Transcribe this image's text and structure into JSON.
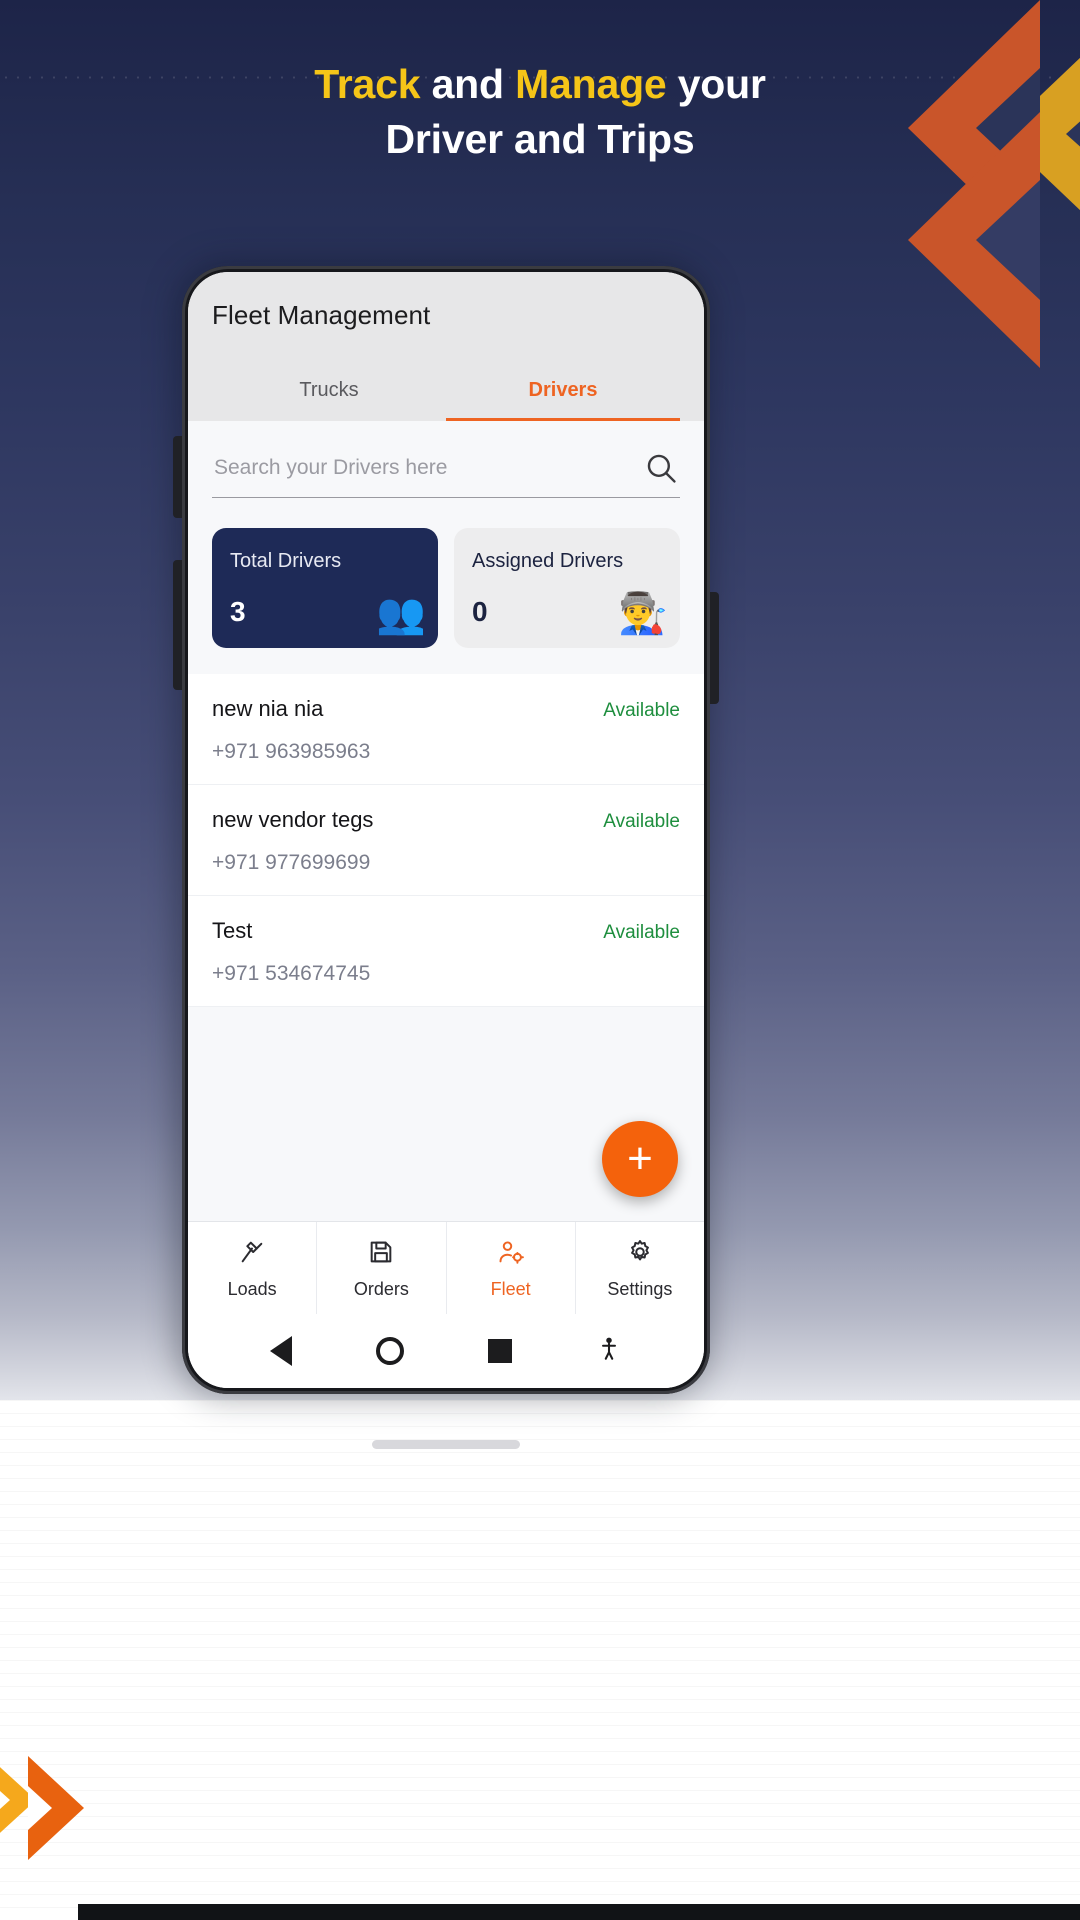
{
  "promo": {
    "headline_part1": "Track",
    "headline_mid1": " and ",
    "headline_part2": "Manage",
    "headline_mid2": " your",
    "headline_line2": "Driver and Trips",
    "accent_gold": "#f5c518",
    "accent_orange": "#c9552a",
    "bg_navy": "#2b3459"
  },
  "app": {
    "title": "Fleet Management",
    "tabs": [
      {
        "label": "Trucks",
        "active": false
      },
      {
        "label": "Drivers",
        "active": true
      }
    ],
    "active_tab_color": "#ee6422",
    "search": {
      "placeholder": "Search your Drivers here",
      "value": "",
      "icon": "search-icon"
    },
    "stats": [
      {
        "label": "Total Drivers",
        "value": "3",
        "emoji": "👥",
        "icon": "drivers-group-icon",
        "theme": "dark",
        "bg": "#1e2a57"
      },
      {
        "label": "Assigned Drivers",
        "value": "0",
        "emoji": "👨‍🏭",
        "icon": "driver-person-icon",
        "theme": "light",
        "bg": "#ededee"
      }
    ],
    "drivers": [
      {
        "name": "new nia nia",
        "phone": "+971 963985963",
        "status": "Available"
      },
      {
        "name": "new vendor tegs",
        "phone": "+971 977699699",
        "status": "Available"
      },
      {
        "name": "Test",
        "phone": "+971 534674745",
        "status": "Available"
      }
    ],
    "status_color": "#1e8e3e",
    "fab": {
      "label": "+",
      "icon": "plus-icon",
      "color": "#f4620c"
    },
    "bottom_nav": [
      {
        "label": "Loads",
        "icon": "loads-icon",
        "active": false
      },
      {
        "label": "Orders",
        "icon": "orders-save-icon",
        "active": false
      },
      {
        "label": "Fleet",
        "icon": "fleet-user-icon",
        "active": true
      },
      {
        "label": "Settings",
        "icon": "gear-icon",
        "active": false
      }
    ],
    "system_nav": [
      {
        "icon": "back-triangle-icon"
      },
      {
        "icon": "home-circle-icon"
      },
      {
        "icon": "recents-square-icon"
      },
      {
        "icon": "accessibility-icon"
      }
    ]
  }
}
